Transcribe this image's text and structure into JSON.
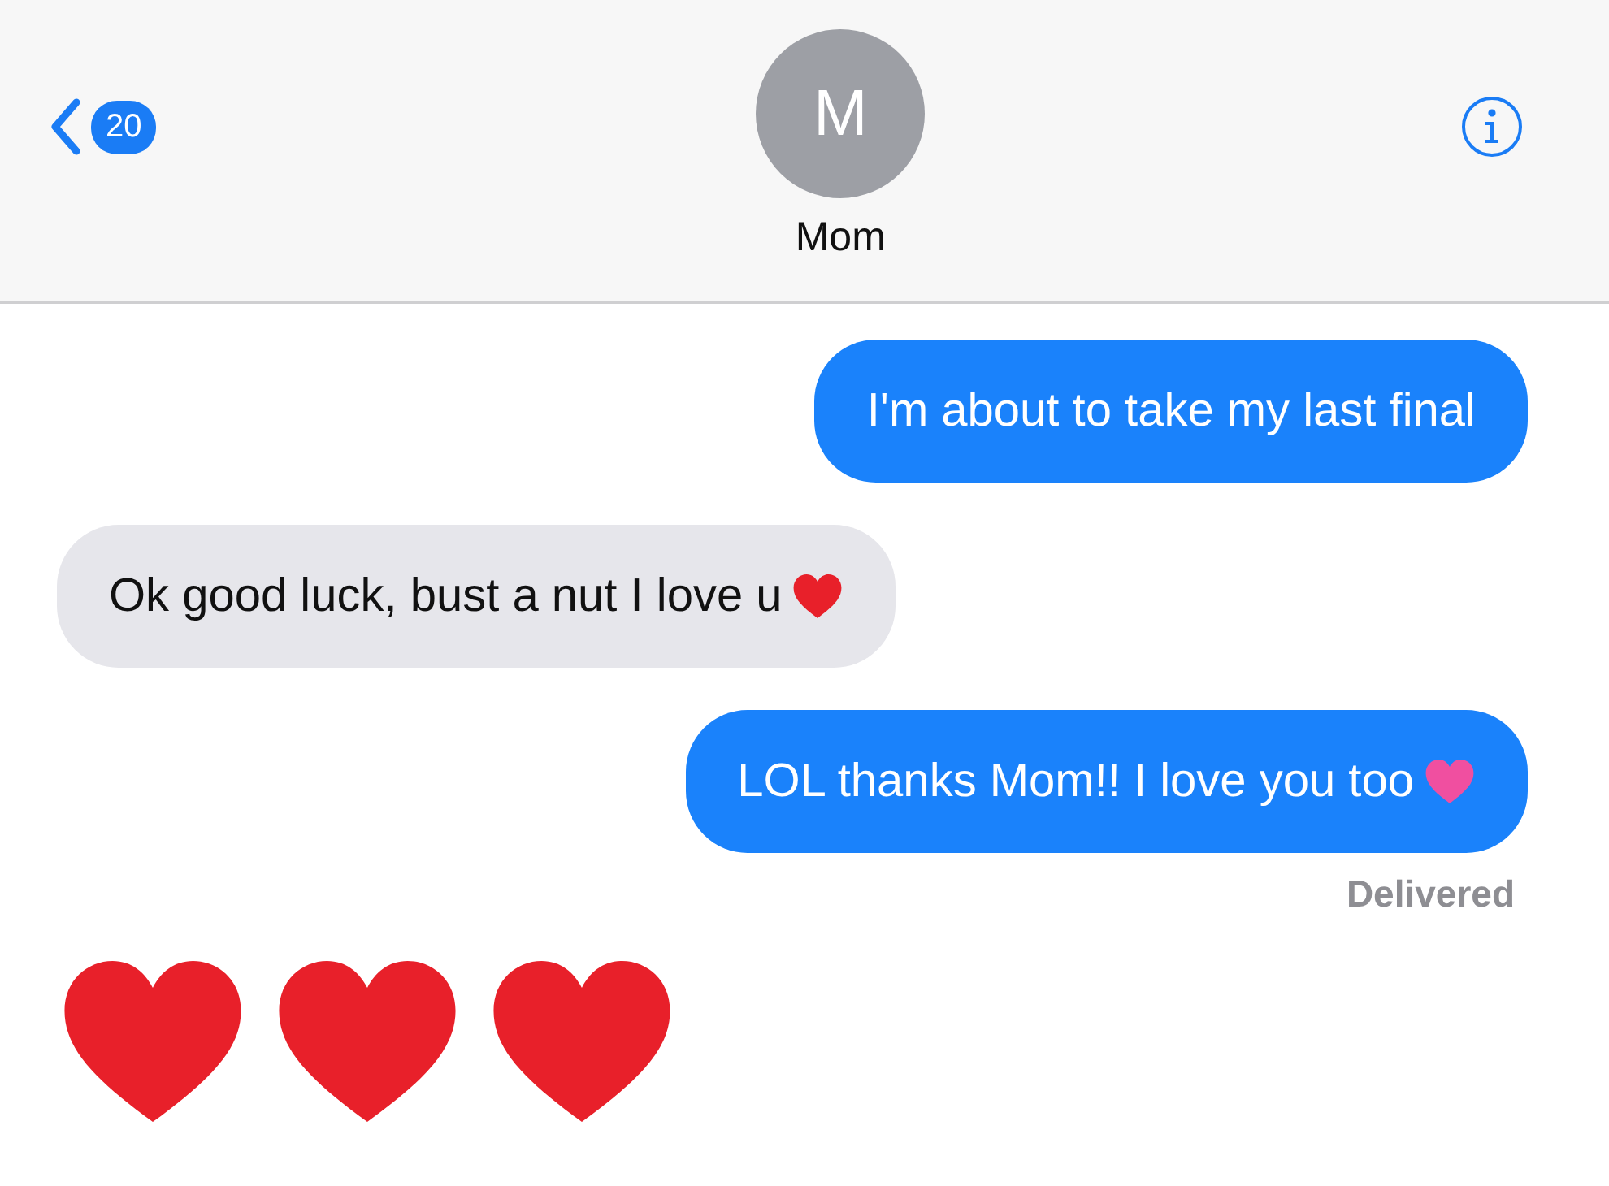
{
  "header": {
    "back_badge": "20",
    "avatar_initial": "M",
    "contact_name": "Mom"
  },
  "messages": [
    {
      "kind": "sent",
      "text": "I'm about to take my last final"
    },
    {
      "kind": "received",
      "text": "Ok good luck, bust a nut I love u",
      "trailing_emoji": {
        "kind": "heart",
        "color": "#e8202a"
      }
    },
    {
      "kind": "sent",
      "text": "LOL thanks Mom!! I love you too",
      "trailing_emoji": {
        "kind": "heart",
        "color": "#f04fa0"
      },
      "status": "Delivered"
    },
    {
      "kind": "emoji",
      "emoji": [
        {
          "kind": "heart",
          "color": "#e8202a"
        },
        {
          "kind": "heart",
          "color": "#e8202a"
        },
        {
          "kind": "heart",
          "color": "#e8202a"
        }
      ]
    }
  ]
}
